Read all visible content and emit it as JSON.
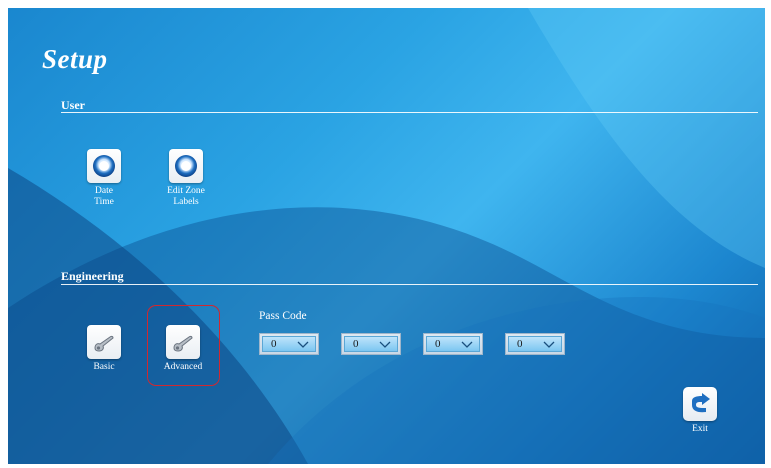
{
  "page": {
    "title": "Setup"
  },
  "user_section": {
    "label": "User",
    "items": [
      {
        "label": "Date\nTime",
        "icon": "circle-button-icon"
      },
      {
        "label": "Edit Zone\nLabels",
        "icon": "circle-button-icon"
      }
    ]
  },
  "engineering_section": {
    "label": "Engineering",
    "items": [
      {
        "label": "Basic",
        "icon": "wrench-icon",
        "selected": false
      },
      {
        "label": "Advanced",
        "icon": "wrench-icon",
        "selected": true
      }
    ],
    "selection_color": "#d2282f"
  },
  "passcode": {
    "label": "Pass Code",
    "digits": [
      "0",
      "0",
      "0",
      "0"
    ]
  },
  "exit": {
    "label": "Exit",
    "icon": "exit-arrow-icon"
  },
  "colors": {
    "background": "#2aa3e3",
    "accent": "#1f6fc1"
  }
}
